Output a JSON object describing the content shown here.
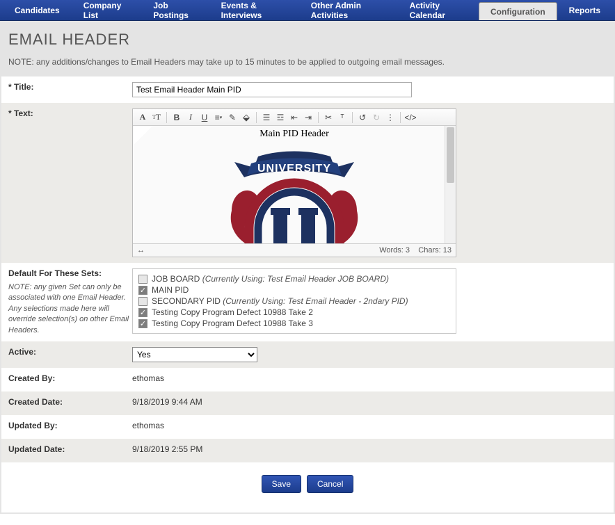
{
  "nav": {
    "tabs": [
      {
        "label": "Candidates"
      },
      {
        "label": "Company List"
      },
      {
        "label": "Job Postings"
      },
      {
        "label": "Events & Interviews"
      },
      {
        "label": "Other Admin Activities"
      },
      {
        "label": "Activity Calendar"
      },
      {
        "label": "Configuration",
        "active": true
      },
      {
        "label": "Reports"
      }
    ]
  },
  "page": {
    "title": "EMAIL HEADER",
    "note": "NOTE: any additions/changes to Email Headers may take up to 15 minutes to be applied to outgoing email messages."
  },
  "form": {
    "title_label": "* Title:",
    "title_value": "Test Email Header Main PID",
    "text_label": "* Text:",
    "sets_label": "Default For These Sets:",
    "sets_note": "NOTE: any given Set can only be associated with one Email Header. Any selections made here will override selection(s) on other Email Headers.",
    "active_label": "Active:",
    "active_value": "Yes",
    "created_by_label": "Created By:",
    "created_by_value": "ethomas",
    "created_date_label": "Created Date:",
    "created_date_value": "9/18/2019 9:44 AM",
    "updated_by_label": "Updated By:",
    "updated_by_value": "ethomas",
    "updated_date_label": "Updated Date:",
    "updated_date_value": "9/18/2019 2:55 PM"
  },
  "editor": {
    "content_heading": "Main PID Header",
    "logo_banner_text": "UNIVERSITY",
    "logo_letter": "U",
    "status_words_label": "Words:",
    "status_words": "3",
    "status_chars_label": "Chars:",
    "status_chars": "13"
  },
  "sets": [
    {
      "checked": false,
      "name": "JOB BOARD",
      "meta": "(Currently Using: Test Email Header JOB BOARD)"
    },
    {
      "checked": true,
      "name": "MAIN PID",
      "meta": ""
    },
    {
      "checked": false,
      "name": "SECONDARY PID",
      "meta": "(Currently Using: Test Email Header - 2ndary PID)"
    },
    {
      "checked": true,
      "name": "Testing Copy Program Defect 10988 Take 2",
      "meta": ""
    },
    {
      "checked": true,
      "name": "Testing Copy Program Defect 10988 Take 3",
      "meta": ""
    }
  ],
  "buttons": {
    "save": "Save",
    "cancel": "Cancel"
  }
}
